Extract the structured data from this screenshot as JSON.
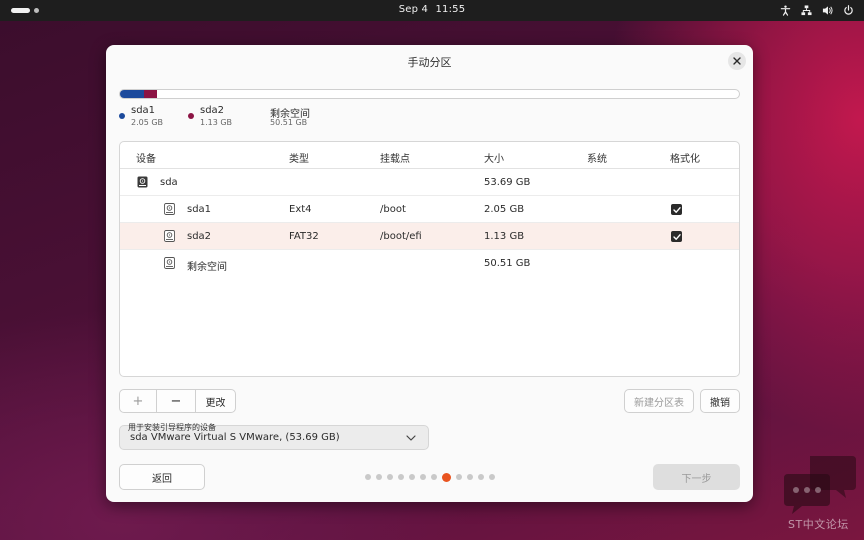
{
  "topbar": {
    "date": "Sep 4",
    "time": "11:55",
    "icons": [
      "accessibility-icon",
      "network-icon",
      "volume-icon",
      "power-icon"
    ]
  },
  "dialog": {
    "title": "手动分区",
    "close_icon": "close-icon"
  },
  "usage": {
    "segments": [
      {
        "name": "sda1",
        "size": "2.05 GB",
        "color": "#1c4a9c",
        "fraction": 0.038
      },
      {
        "name": "sda2",
        "size": "1.13 GB",
        "color": "#8c1444",
        "fraction": 0.021
      },
      {
        "name": "剩余空间",
        "size": "50.51 GB",
        "color": "#ffffff",
        "fraction": 0.941
      }
    ]
  },
  "table": {
    "headers": {
      "device": "设备",
      "type": "类型",
      "mount": "挂载点",
      "size": "大小",
      "system": "系统",
      "format": "格式化"
    },
    "rows": [
      {
        "device": "sda",
        "type": "",
        "mount": "",
        "size": "53.69 GB",
        "format": null,
        "icon": "hard-disk-icon"
      },
      {
        "device": "sda1",
        "type": "Ext4",
        "mount": "/boot",
        "size": "2.05 GB",
        "format": true,
        "icon": "partition-icon"
      },
      {
        "device": "sda2",
        "type": "FAT32",
        "mount": "/boot/efi",
        "size": "1.13 GB",
        "format": true,
        "icon": "partition-icon",
        "selected": true
      },
      {
        "device": "剩余空间",
        "type": "",
        "mount": "",
        "size": "50.51 GB",
        "format": null,
        "icon": "partition-icon"
      }
    ]
  },
  "actions": {
    "add": "+",
    "remove": "−",
    "change": "更改",
    "new_table": "新建分区表",
    "revert": "撤销"
  },
  "bootloader": {
    "label": "用于安装引导程序的设备",
    "value": "sda VMware Virtual S VMware, (53.69 GB)"
  },
  "footer": {
    "back": "返回",
    "next": "下一步",
    "pages_total": 12,
    "page_current": 8
  },
  "watermark": {
    "text": "ST中文论坛"
  },
  "colors": {
    "accent": "#e95420",
    "selected_row": "#fbeeea"
  }
}
